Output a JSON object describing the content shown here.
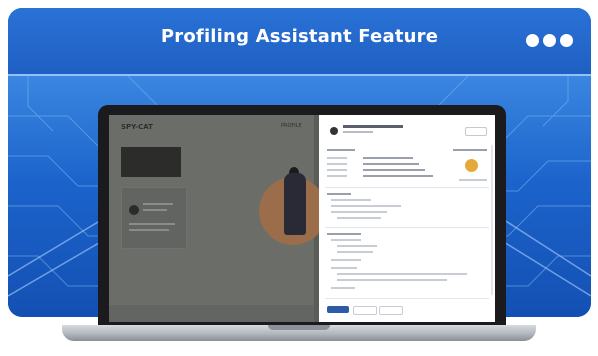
{
  "header": {
    "title": "Profiling Assistant Feature",
    "menu_icon": "more-dots-icon"
  },
  "colors": {
    "header_blue": "#1f5fc3",
    "background_blue": "#1b63cb",
    "accent_gold": "#e5a93b"
  },
  "laptop": {
    "screen_content": "profiling-assistant-panel-screenshot"
  }
}
